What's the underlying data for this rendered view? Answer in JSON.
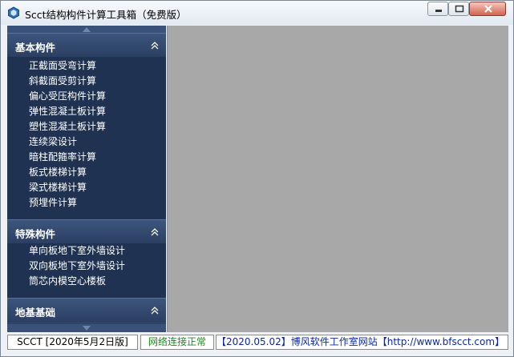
{
  "window": {
    "title": "Scct结构构件计算工具箱（免费版）"
  },
  "sidebar": {
    "sections": [
      {
        "label": "基本构件",
        "items": [
          "正截面受弯计算",
          "斜截面受剪计算",
          "偏心受压构件计算",
          "弹性混凝土板计算",
          "塑性混凝土板计算",
          "连续梁设计",
          "暗柱配箍率计算",
          "板式楼梯计算",
          "梁式楼梯计算",
          "预埋件计算"
        ]
      },
      {
        "label": "特殊构件",
        "items": [
          "单向板地下室外墙设计",
          "双向板地下室外墙设计",
          "筒芯内模空心楼板"
        ]
      },
      {
        "label": "地基基础",
        "items": []
      }
    ]
  },
  "status": {
    "version": "SCCT [2020年5月2日版]",
    "network": "网络连接正常",
    "ticker": "【2020.05.02】博风软件工作室网站【http://www.bfscct.com】"
  },
  "colors": {
    "sidebar_bg": "#2e4469",
    "main_bg": "#a8a8a8",
    "network_ok": "#1d8c1d",
    "ticker_text": "#0a2aa3"
  }
}
